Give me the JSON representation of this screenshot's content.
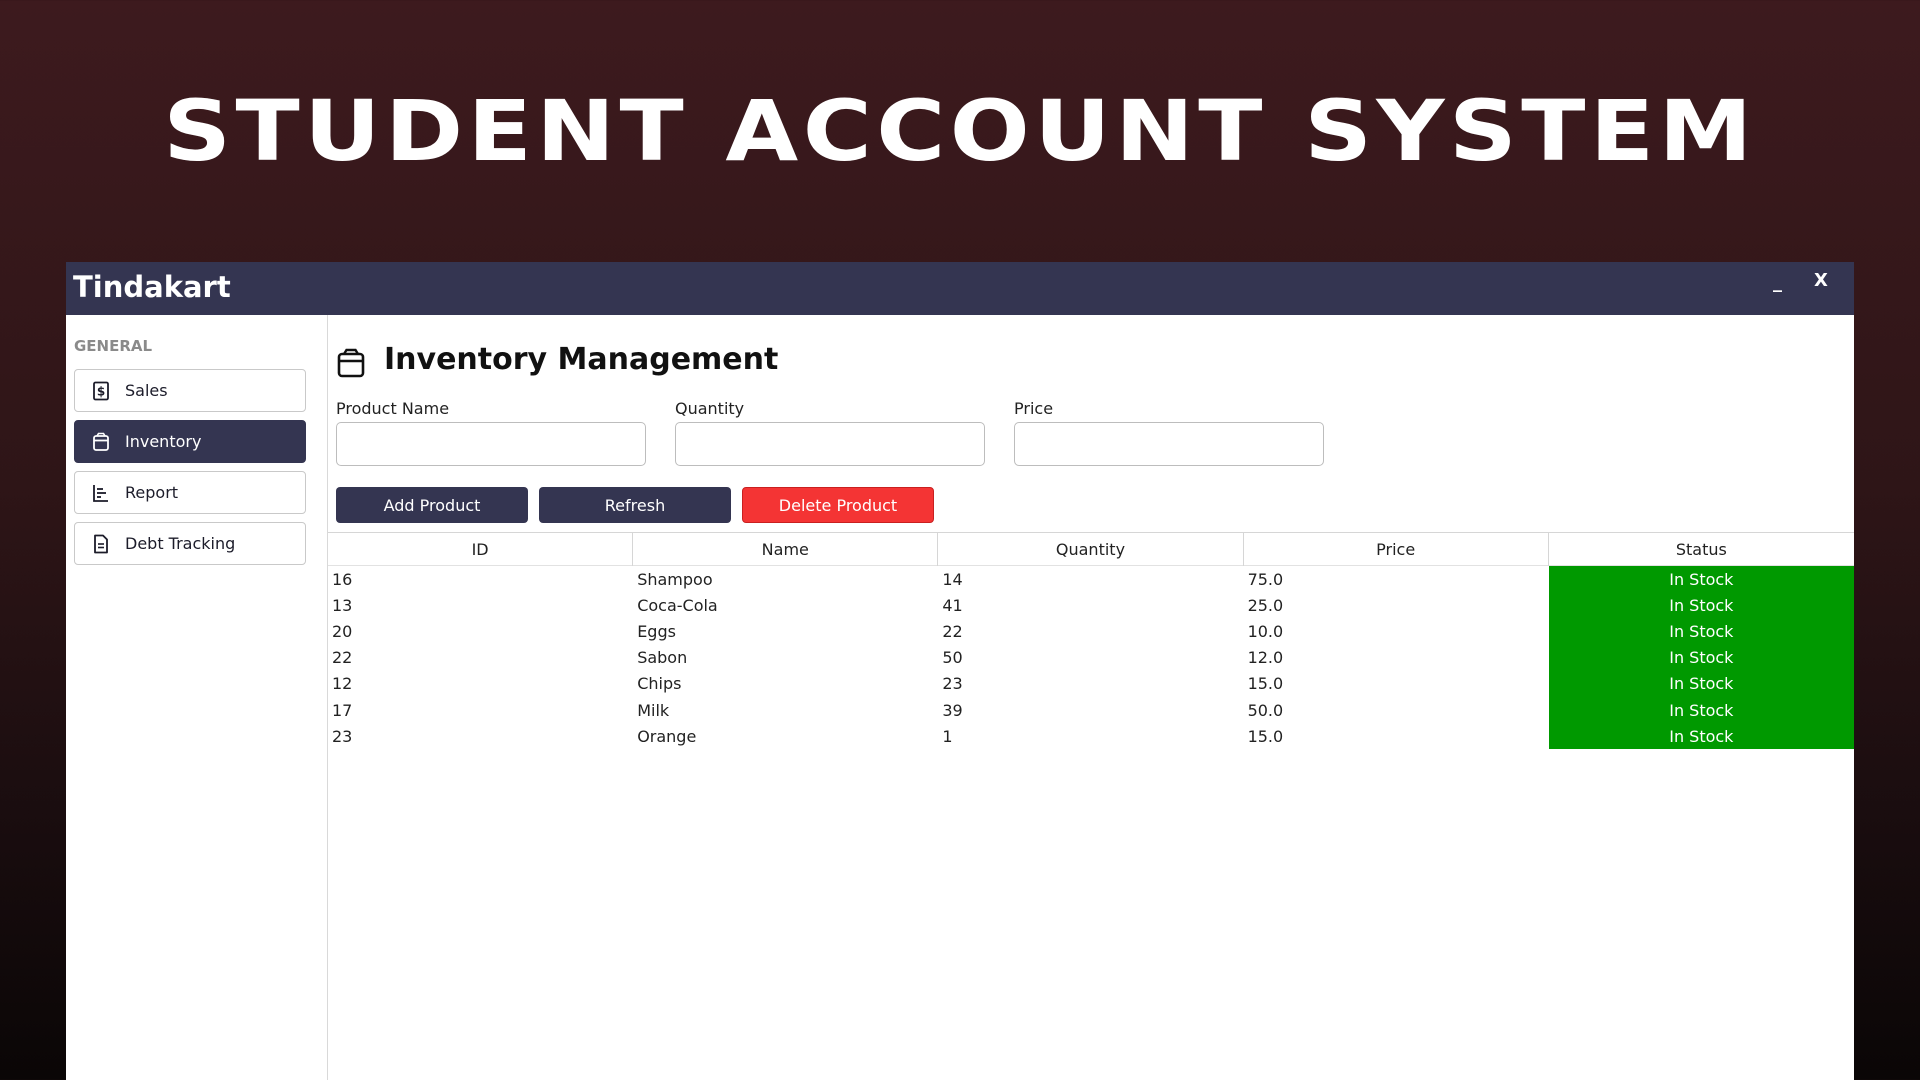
{
  "banner": {
    "title": "STUDENT ACCOUNT SYSTEM"
  },
  "window": {
    "title": "Tindakart",
    "minimize": "_",
    "close": "X"
  },
  "sidebar": {
    "section": "GENERAL",
    "items": [
      {
        "label": "Sales",
        "icon": "dollar-icon",
        "active": false
      },
      {
        "label": "Inventory",
        "icon": "box-icon",
        "active": true
      },
      {
        "label": "Report",
        "icon": "chart-icon",
        "active": false
      },
      {
        "label": "Debt Tracking",
        "icon": "document-icon",
        "active": false
      }
    ]
  },
  "main": {
    "title": "Inventory Management",
    "icon": "box-icon",
    "fields": [
      {
        "label": "Product Name",
        "value": ""
      },
      {
        "label": "Quantity",
        "value": ""
      },
      {
        "label": "Price",
        "value": ""
      }
    ],
    "buttons": {
      "add": "Add Product",
      "refresh": "Refresh",
      "delete": "Delete Product"
    }
  },
  "table": {
    "columns": [
      "ID",
      "Name",
      "Quantity",
      "Price",
      "Status"
    ],
    "rows": [
      [
        "16",
        "Shampoo",
        "14",
        "75.0",
        "In Stock"
      ],
      [
        "13",
        "Coca-Cola",
        "41",
        "25.0",
        "In Stock"
      ],
      [
        "20",
        "Eggs",
        "22",
        "10.0",
        "In Stock"
      ],
      [
        "22",
        "Sabon",
        "50",
        "12.0",
        "In Stock"
      ],
      [
        "12",
        "Chips",
        "23",
        "15.0",
        "In Stock"
      ],
      [
        "17",
        "Milk",
        "39",
        "50.0",
        "In Stock"
      ],
      [
        "23",
        "Orange",
        "1",
        "15.0",
        "In Stock"
      ]
    ]
  },
  "colors": {
    "titlebar": "#343551",
    "active_nav": "#343551",
    "delete_button": "#f43434",
    "status_in_stock": "#009900",
    "background": "#2e1517"
  }
}
